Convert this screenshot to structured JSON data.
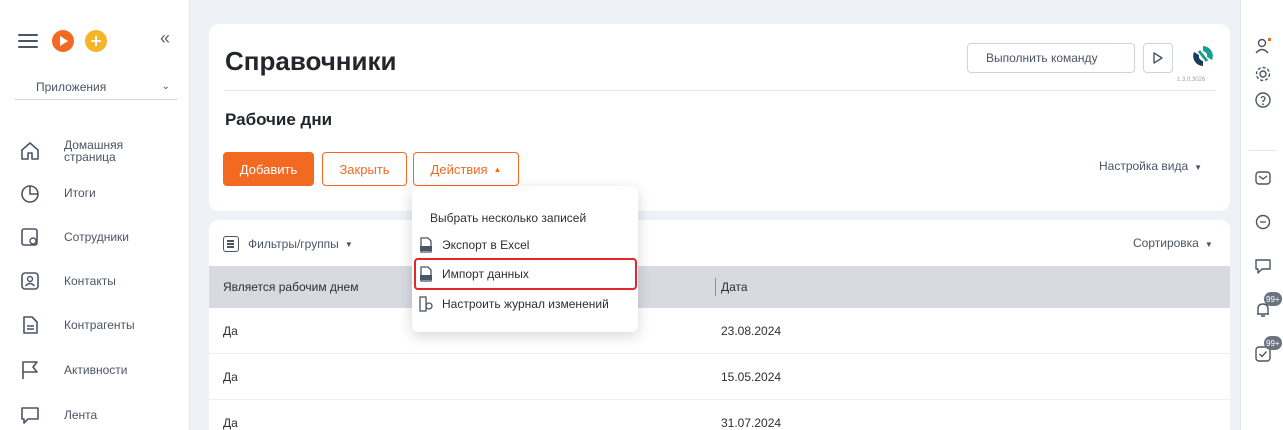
{
  "sidebar": {
    "apps_label": "Приложения",
    "items": [
      {
        "label": "Домашняя страница",
        "icon": "home-icon"
      },
      {
        "label": "Итоги",
        "icon": "pie-chart-icon"
      },
      {
        "label": "Сотрудники",
        "icon": "employees-icon"
      },
      {
        "label": "Контакты",
        "icon": "contact-icon"
      },
      {
        "label": "Контрагенты",
        "icon": "document-icon"
      },
      {
        "label": "Активности",
        "icon": "flag-icon"
      },
      {
        "label": "Лента",
        "icon": "chat-icon"
      }
    ]
  },
  "header": {
    "title": "Справочники",
    "command_placeholder": "Выполнить команду",
    "version": "1.3.0.3026"
  },
  "section": {
    "title": "Рабочие дни",
    "add_label": "Добавить",
    "close_label": "Закрыть",
    "actions_label": "Действия",
    "view_setup_label": "Настройка вида"
  },
  "actions_menu": {
    "items": [
      {
        "label": "Выбрать несколько записей",
        "icon": ""
      },
      {
        "label": "Экспорт в Excel",
        "icon": "xls-icon"
      },
      {
        "label": "Импорт данных",
        "icon": "import-icon",
        "highlighted": true
      },
      {
        "label": "Настроить журнал изменений",
        "icon": "log-settings-icon"
      }
    ]
  },
  "table": {
    "filters_label": "Фильтры/группы",
    "sort_label": "Сортировка",
    "columns": [
      "Является рабочим днем",
      "Дата"
    ],
    "rows": [
      [
        "Да",
        "23.08.2024"
      ],
      [
        "Да",
        "15.05.2024"
      ],
      [
        "Да",
        "31.07.2024"
      ]
    ]
  },
  "rail": {
    "notifications_badge": "99+",
    "tasks_badge": "99+"
  },
  "colors": {
    "accent": "#f26a21",
    "highlight": "#e3262b",
    "header_bg": "#d7dbe1"
  }
}
